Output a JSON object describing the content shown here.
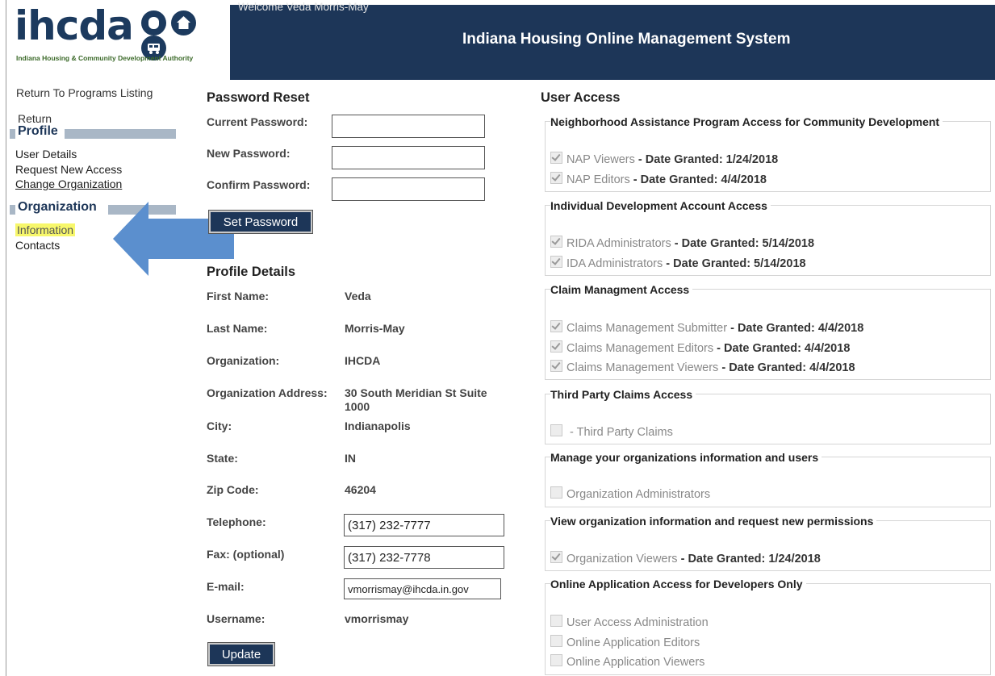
{
  "header": {
    "logo_text": "ihcda",
    "logo_subtitle": "Indiana Housing & Community Development Authority",
    "welcome": "Welcome Veda Morris-May",
    "system_title": "Indiana Housing Online Management System"
  },
  "sidebar": {
    "return_programs": "Return To Programs Listing",
    "return": "Return",
    "profile_heading": "Profile",
    "user_details": "User Details",
    "request_new_access": "Request New Access",
    "change_organization": "Change Organization",
    "organization_heading": "Organization",
    "information": "Information",
    "contacts": "Contacts"
  },
  "password_reset": {
    "heading": "Password Reset",
    "current_label": "Current Password:",
    "new_label": "New Password:",
    "confirm_label": "Confirm Password:",
    "set_button": "Set Password"
  },
  "profile": {
    "heading": "Profile Details",
    "first_name_label": "First Name:",
    "first_name": "Veda",
    "last_name_label": "Last Name:",
    "last_name": "Morris-May",
    "org_label": "Organization:",
    "org": "IHCDA",
    "org_address_label": "Organization Address:",
    "org_address_1": "30 South Meridian St Suite",
    "org_address_2": "1000",
    "city_label": "City:",
    "city": "Indianapolis",
    "state_label": "State:",
    "state": "IN",
    "zip_label": "Zip Code:",
    "zip": "46204",
    "telephone_label": "Telephone:",
    "telephone": "(317) 232-7777",
    "fax_label": "Fax: (optional)",
    "fax": "(317) 232-7778",
    "email_label": "E-mail:",
    "email": "vmorrismay@ihcda.in.gov",
    "username_label": "Username:",
    "username": "vmorrismay",
    "update_button": "Update"
  },
  "user_access": {
    "heading": "User Access",
    "groups": [
      {
        "title": "Neighborhood Assistance Program Access for Community Development",
        "items": [
          {
            "name": "NAP Viewers",
            "date": "- Date Granted: 1/24/2018",
            "checked": true
          },
          {
            "name": "NAP Editors",
            "date": "- Date Granted: 4/4/2018",
            "checked": true
          }
        ]
      },
      {
        "title": "Individual Development Account Access",
        "items": [
          {
            "name": "RIDA Administrators",
            "date": "- Date Granted: 5/14/2018",
            "checked": true
          },
          {
            "name": "IDA Administrators",
            "date": "- Date Granted: 5/14/2018",
            "checked": true
          }
        ]
      },
      {
        "title": "Claim Managment Access",
        "items": [
          {
            "name": "Claims Management Submitter",
            "date": "- Date Granted: 4/4/2018",
            "checked": true
          },
          {
            "name": "Claims Management Editors",
            "date": "- Date Granted: 4/4/2018",
            "checked": true
          },
          {
            "name": "Claims Management Viewers",
            "date": "- Date Granted: 4/4/2018",
            "checked": true
          }
        ]
      },
      {
        "title": "Third Party Claims Access",
        "items": [
          {
            "name": "",
            "date": "- Third Party Claims",
            "checked": false
          }
        ]
      },
      {
        "title": "Manage your organizations information and users",
        "items": [
          {
            "name": "Organization Administrators",
            "date": "",
            "checked": false
          }
        ]
      },
      {
        "title": "View organization information and request new permissions",
        "items": [
          {
            "name": "Organization Viewers",
            "date": "- Date Granted: 1/24/2018",
            "checked": true
          }
        ]
      },
      {
        "title": "Online Application Access for Developers Only",
        "items": [
          {
            "name": "User Access Administration",
            "date": "",
            "checked": false
          },
          {
            "name": "Online Application Editors",
            "date": "",
            "checked": false
          },
          {
            "name": "Online Application Viewers",
            "date": "",
            "checked": false
          }
        ]
      }
    ]
  },
  "colors": {
    "header_navy": "#1d3658",
    "highlight_yellow": "#f7f76b",
    "arrow_blue": "#5b8fce"
  }
}
